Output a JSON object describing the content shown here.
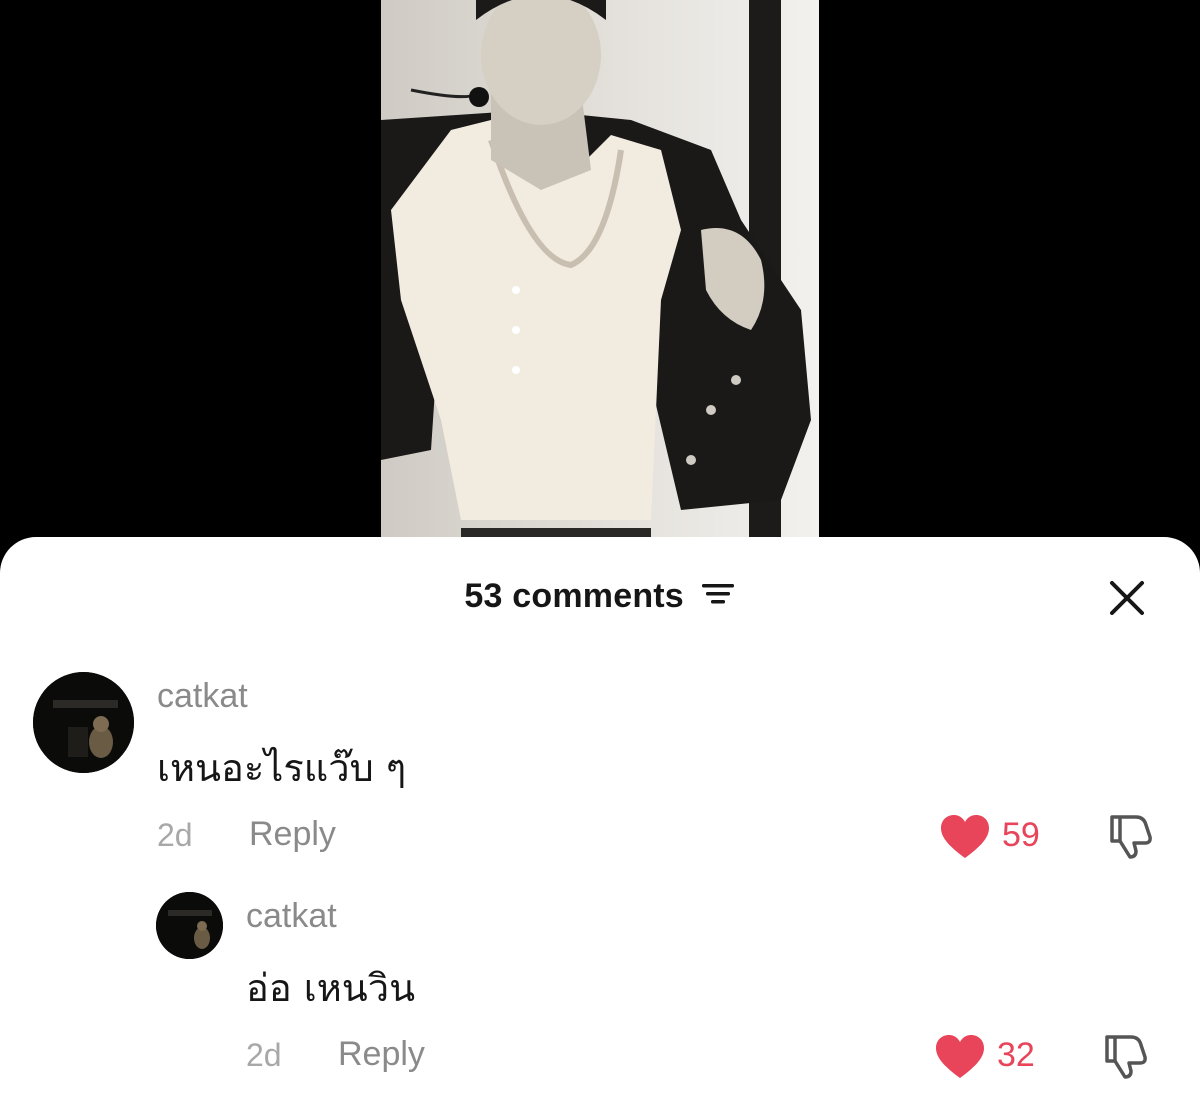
{
  "header": {
    "comments_count_label": "53 comments"
  },
  "comments": [
    {
      "username": "catkat",
      "text": "เหนอะไรแว๊บ ๆ",
      "time": "2d",
      "reply_label": "Reply",
      "likes": "59"
    },
    {
      "username": "catkat",
      "text": "อ่อ เหนวิน",
      "time": "2d",
      "reply_label": "Reply",
      "likes": "32"
    }
  ],
  "colors": {
    "like": "#e8445a",
    "username": "#8a8a8a",
    "text": "#161616"
  },
  "icons": [
    "sort-icon",
    "close-icon",
    "heart-icon",
    "dislike-icon"
  ]
}
